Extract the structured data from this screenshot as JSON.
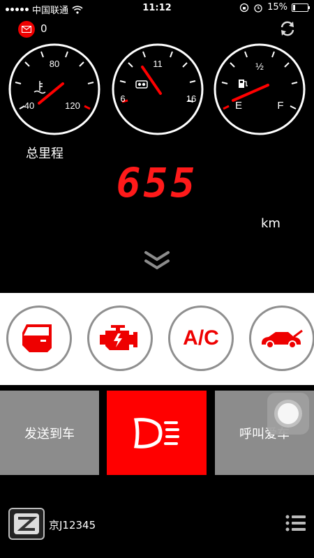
{
  "status_bar": {
    "carrier": "中国联通",
    "time": "11:12",
    "battery": "15%",
    "battery_level": 0.15
  },
  "header": {
    "message_count": "0"
  },
  "gauges": {
    "temperature": {
      "ticks": [
        "40",
        "80",
        "120"
      ],
      "icon": "coolant-temperature-icon"
    },
    "rpm": {
      "ticks": [
        "6",
        "11",
        "16"
      ],
      "icon": "engine-oil-icon"
    },
    "fuel": {
      "ticks": [
        "E",
        "½",
        "F"
      ],
      "icon": "fuel-pump-icon"
    }
  },
  "odometer": {
    "label": "总里程",
    "value": "655",
    "unit": "km"
  },
  "controls": {
    "door": "car-door-icon",
    "engine": "engine-warning-icon",
    "ac_label": "A/C",
    "trunk": "car-trunk-icon"
  },
  "actions": {
    "send_to_car": "发送到车",
    "headlight": "headlight-icon",
    "call_car": "呼叫爱车"
  },
  "footer": {
    "plate": "京J12345"
  },
  "colors": {
    "accent": "#ff0000",
    "gray_button": "#8c8c8c"
  }
}
